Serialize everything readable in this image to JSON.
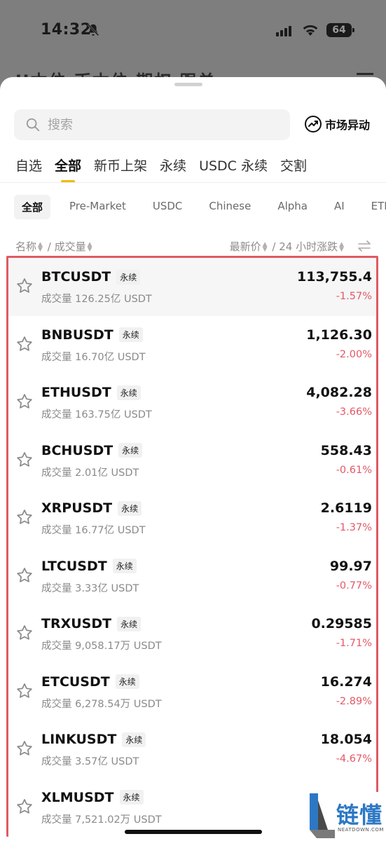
{
  "status_bar": {
    "time": "14:32",
    "battery": "64"
  },
  "background_tabs": "U本位  币本位  期权  跟单",
  "search": {
    "placeholder": "搜索"
  },
  "market_movers_label": "市场异动",
  "main_tabs": [
    {
      "label": "自选",
      "active": false
    },
    {
      "label": "全部",
      "active": true
    },
    {
      "label": "新币上架",
      "active": false
    },
    {
      "label": "永续",
      "active": false
    },
    {
      "label": "USDC 永续",
      "active": false
    },
    {
      "label": "交割",
      "active": false
    }
  ],
  "filter_chips": [
    {
      "label": "全部",
      "active": true
    },
    {
      "label": "Pre-Market",
      "active": false
    },
    {
      "label": "USDC",
      "active": false
    },
    {
      "label": "Chinese",
      "active": false
    },
    {
      "label": "Alpha",
      "active": false
    },
    {
      "label": "AI",
      "active": false
    },
    {
      "label": "ETF",
      "active": false
    }
  ],
  "sort_header": {
    "name": "名称",
    "separator": "/",
    "volume": "成交量",
    "last_price": "最新价",
    "change_24h": "24 小时涨跌"
  },
  "accent_colors": {
    "negative": "#e35865",
    "tab_indicator": "#f0b90b",
    "highlight_border": "#e05a63"
  },
  "rows": [
    {
      "symbol": "BTCUSDT",
      "tag": "永续",
      "volume": "成交量 126.25亿 USDT",
      "price": "113,755.4",
      "change": "-1.57%"
    },
    {
      "symbol": "BNBUSDT",
      "tag": "永续",
      "volume": "成交量 16.70亿 USDT",
      "price": "1,126.30",
      "change": "-2.00%"
    },
    {
      "symbol": "ETHUSDT",
      "tag": "永续",
      "volume": "成交量 163.75亿 USDT",
      "price": "4,082.28",
      "change": "-3.66%"
    },
    {
      "symbol": "BCHUSDT",
      "tag": "永续",
      "volume": "成交量 2.01亿 USDT",
      "price": "558.43",
      "change": "-0.61%"
    },
    {
      "symbol": "XRPUSDT",
      "tag": "永续",
      "volume": "成交量 16.77亿 USDT",
      "price": "2.6119",
      "change": "-1.37%"
    },
    {
      "symbol": "LTCUSDT",
      "tag": "永续",
      "volume": "成交量 3.33亿 USDT",
      "price": "99.97",
      "change": "-0.77%"
    },
    {
      "symbol": "TRXUSDT",
      "tag": "永续",
      "volume": "成交量 9,058.17万 USDT",
      "price": "0.29585",
      "change": "-1.71%"
    },
    {
      "symbol": "ETCUSDT",
      "tag": "永续",
      "volume": "成交量 6,278.54万 USDT",
      "price": "16.274",
      "change": "-2.89%"
    },
    {
      "symbol": "LINKUSDT",
      "tag": "永续",
      "volume": "成交量 3.57亿 USDT",
      "price": "18.054",
      "change": "-4.67%"
    },
    {
      "symbol": "XLMUSDT",
      "tag": "永续",
      "volume": "成交量 7,521.02万 USDT",
      "price": "",
      "change": ""
    }
  ],
  "watermark": {
    "text": "链懂",
    "sub": "NEATDOWN.COM"
  }
}
